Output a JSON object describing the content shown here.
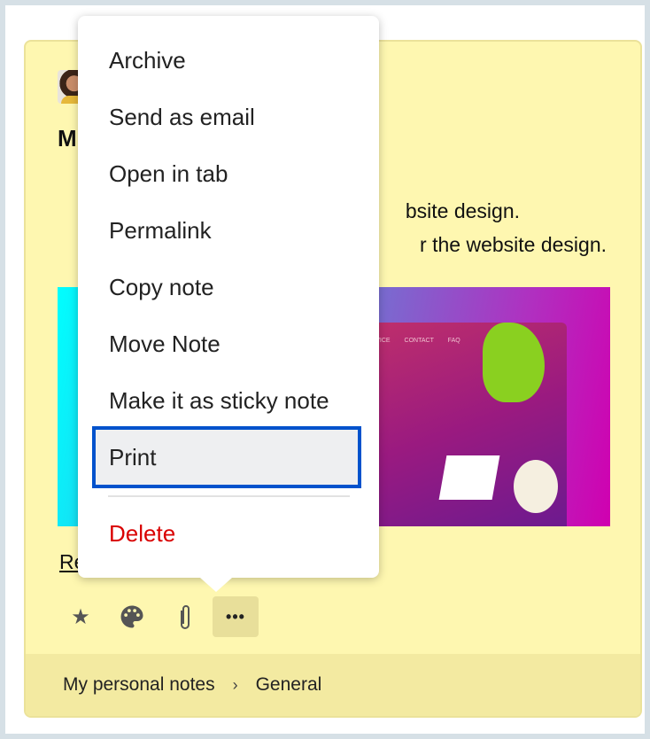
{
  "note": {
    "title_visible": "M",
    "body_lines": [
      "bsite design.",
      "r the website design."
    ],
    "image_nav": "SERVICE CONTACT FAQ",
    "link_visible": "Re"
  },
  "toolbar": {
    "icons": [
      "star-icon",
      "palette-icon",
      "paperclip-icon",
      "more-icon"
    ],
    "more": "•••"
  },
  "breadcrumb": {
    "items": [
      "My personal notes",
      "General"
    ],
    "separator": "›"
  },
  "menu": {
    "items": [
      "Archive",
      "Send as email",
      "Open in tab",
      "Permalink",
      "Copy note",
      "Move Note",
      "Make it as sticky note",
      "Print"
    ],
    "selected": "Print",
    "delete": "Delete"
  },
  "colors": {
    "note_bg": "#fef7b0",
    "focus": "#0052cc",
    "danger": "#d90000"
  }
}
